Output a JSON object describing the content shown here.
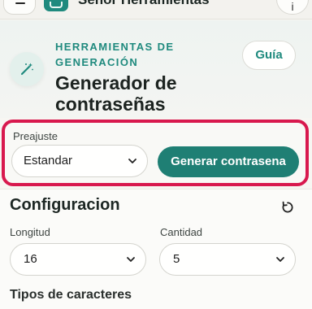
{
  "topbar": {
    "app_title": "Señor Herramientas",
    "menu_icon": "hamburger-icon",
    "logo_icon": "toolbox-icon",
    "info_label": "i"
  },
  "header": {
    "icon": "magic-wand-icon",
    "eyebrow": "HERRAMIENTAS DE GENERACIÓN",
    "title": "Generador de contraseñas",
    "guide_label": "Guía"
  },
  "preset": {
    "label": "Preajuste",
    "selected": "Estandar",
    "generate_label": "Generar contrasena",
    "highlight_color": "#d8194e"
  },
  "config": {
    "title": "Configuracion",
    "reset_icon": "reset-icon",
    "length_label": "Longitud",
    "length_value": "16",
    "quantity_label": "Cantidad",
    "quantity_value": "5",
    "types_label": "Tipos de caracteres"
  },
  "colors": {
    "accent": "#1f8a7e",
    "button": "#1f7f74"
  }
}
